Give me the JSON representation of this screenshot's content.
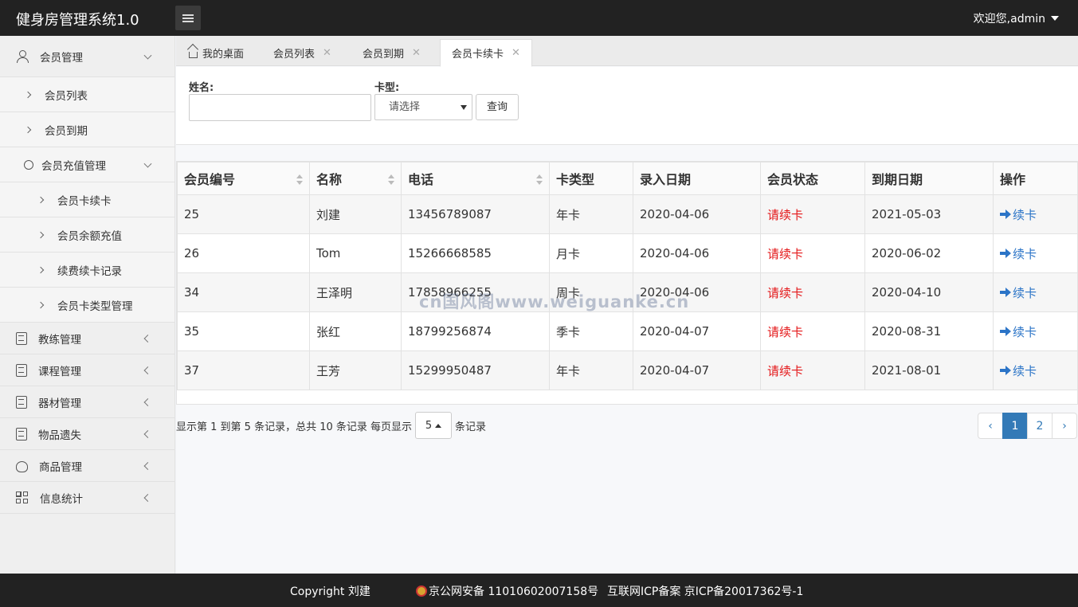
{
  "header": {
    "app_title": "健身房管理系统1.0",
    "welcome": "欢迎您,admin"
  },
  "sidebar": {
    "member_mgmt": "会员管理",
    "member_list": "会员列表",
    "member_expire": "会员到期",
    "member_recharge_mgmt": "会员充值管理",
    "card_renew": "会员卡续卡",
    "balance_recharge": "会员余额充值",
    "renew_records": "续费续卡记录",
    "card_type_mgmt": "会员卡类型管理",
    "coach_mgmt": "教练管理",
    "course_mgmt": "课程管理",
    "equipment_mgmt": "器材管理",
    "lost_items": "物品遗失",
    "goods_mgmt": "商品管理",
    "statistics": "信息统计"
  },
  "tabs": {
    "home": "我的桌面",
    "member_list": "会员列表",
    "member_expire": "会员到期",
    "card_renew": "会员卡续卡",
    "close_glyph": "✕"
  },
  "search": {
    "name_label": "姓名:",
    "name_value": "",
    "card_type_label": "卡型:",
    "card_type_selected": "请选择",
    "query_button": "查询"
  },
  "table": {
    "headers": {
      "id": "会员编号",
      "name": "名称",
      "phone": "电话",
      "card_type": "卡类型",
      "entry_date": "录入日期",
      "status": "会员状态",
      "expire_date": "到期日期",
      "action": "操作"
    },
    "rows": [
      {
        "id": "25",
        "name": "刘建",
        "phone": "13456789087",
        "card_type": "年卡",
        "entry_date": "2020-04-06",
        "status": "请续卡",
        "expire_date": "2021-05-03",
        "action": "续卡"
      },
      {
        "id": "26",
        "name": "Tom",
        "phone": "15266668585",
        "card_type": "月卡",
        "entry_date": "2020-04-06",
        "status": "请续卡",
        "expire_date": "2020-06-02",
        "action": "续卡"
      },
      {
        "id": "34",
        "name": "王泽明",
        "phone": "17858966255",
        "card_type": "周卡",
        "entry_date": "2020-04-06",
        "status": "请续卡",
        "expire_date": "2020-04-10",
        "action": "续卡"
      },
      {
        "id": "35",
        "name": "张红",
        "phone": "18799256874",
        "card_type": "季卡",
        "entry_date": "2020-04-07",
        "status": "请续卡",
        "expire_date": "2020-08-31",
        "action": "续卡"
      },
      {
        "id": "37",
        "name": "王芳",
        "phone": "15299950487",
        "card_type": "年卡",
        "entry_date": "2020-04-07",
        "status": "请续卡",
        "expire_date": "2021-08-01",
        "action": "续卡"
      }
    ]
  },
  "pager": {
    "info_prefix": "显示第 1 到第 5 条记录，总共 10 条记录 每页显示",
    "page_size": "5",
    "info_suffix": "条记录",
    "prev": "‹",
    "pages": [
      "1",
      "2"
    ],
    "next": "›"
  },
  "watermark": "cn国风阁www.weiguanke.cn",
  "footer": {
    "copyright": "Copyright 刘建",
    "police_record": "京公网安备 11010602007158号",
    "icp_record": "互联网ICP备案 京ICP备20017362号-1"
  },
  "colors": {
    "header_bg": "#222222",
    "status_red": "#e4181a",
    "link_blue": "#2b74c7",
    "page_active": "#337ab7"
  }
}
